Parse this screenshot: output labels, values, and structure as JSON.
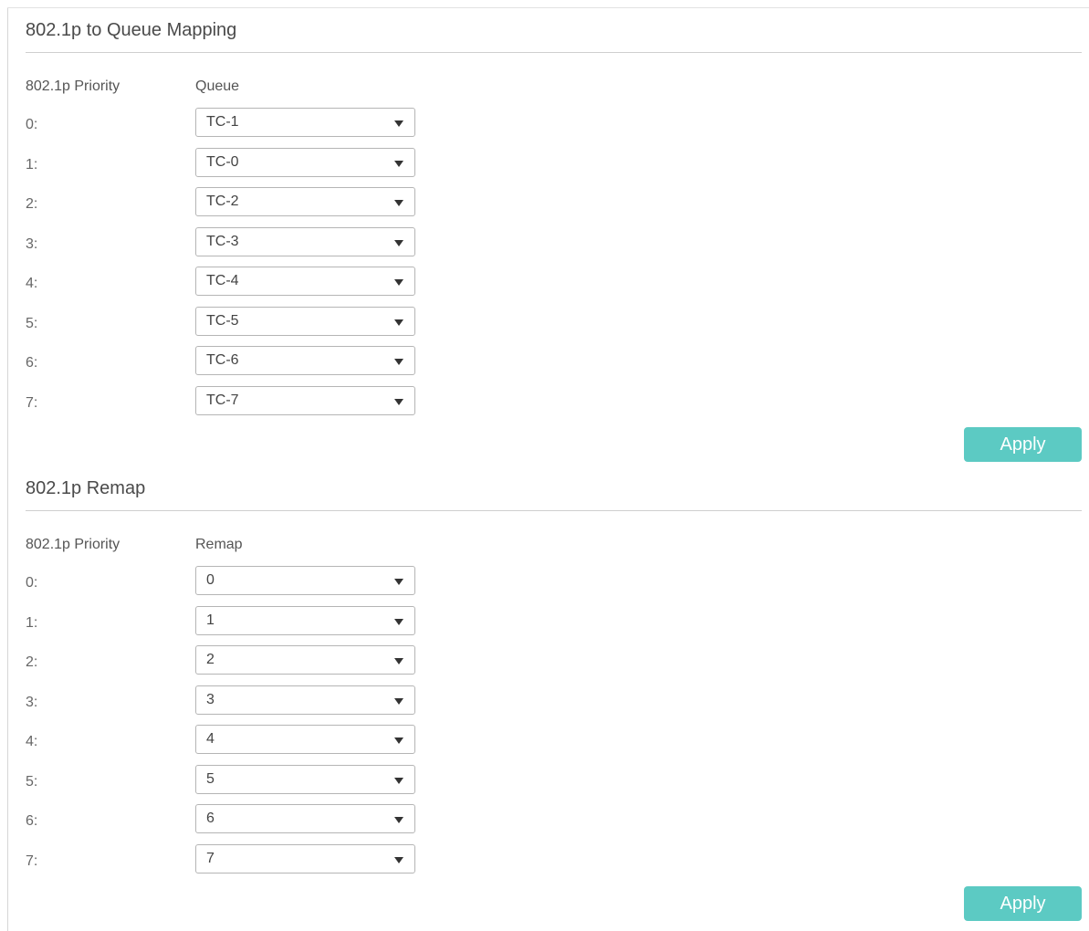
{
  "queue_mapping": {
    "title": "802.1p to Queue Mapping",
    "col_priority": "802.1p Priority",
    "col_value": "Queue",
    "rows": [
      {
        "label": "0:",
        "value": "TC-1"
      },
      {
        "label": "1:",
        "value": "TC-0"
      },
      {
        "label": "2:",
        "value": "TC-2"
      },
      {
        "label": "3:",
        "value": "TC-3"
      },
      {
        "label": "4:",
        "value": "TC-4"
      },
      {
        "label": "5:",
        "value": "TC-5"
      },
      {
        "label": "6:",
        "value": "TC-6"
      },
      {
        "label": "7:",
        "value": "TC-7"
      }
    ],
    "apply_label": "Apply"
  },
  "remap": {
    "title": "802.1p Remap",
    "col_priority": "802.1p Priority",
    "col_value": "Remap",
    "rows": [
      {
        "label": "0:",
        "value": "0"
      },
      {
        "label": "1:",
        "value": "1"
      },
      {
        "label": "2:",
        "value": "2"
      },
      {
        "label": "3:",
        "value": "3"
      },
      {
        "label": "4:",
        "value": "4"
      },
      {
        "label": "5:",
        "value": "5"
      },
      {
        "label": "6:",
        "value": "6"
      },
      {
        "label": "7:",
        "value": "7"
      }
    ],
    "apply_label": "Apply"
  },
  "colors": {
    "accent": "#5ccac3",
    "border": "#b5b5b5",
    "divider": "#cfcfcf"
  },
  "icons": {
    "dropdown": "chevron-down-icon"
  }
}
